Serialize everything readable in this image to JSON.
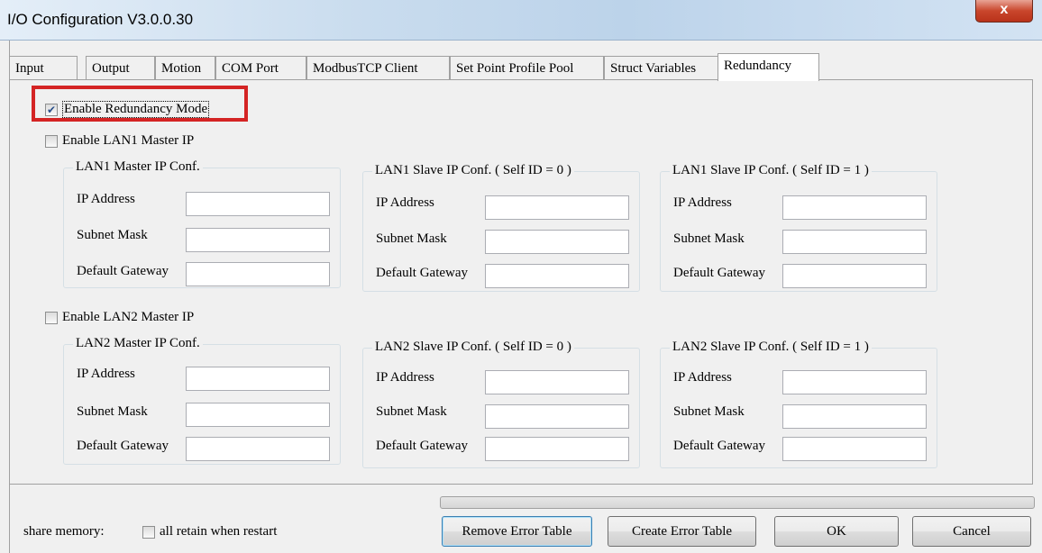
{
  "window": {
    "title": "I/O Configuration V3.0.0.30",
    "close_glyph": "x"
  },
  "tabs": [
    {
      "label": "Input",
      "active": false
    },
    {
      "label": "Output",
      "active": false
    },
    {
      "label": "Motion",
      "active": false
    },
    {
      "label": "COM Port",
      "active": false
    },
    {
      "label": "ModbusTCP Client",
      "active": false
    },
    {
      "label": "Set Point Profile Pool",
      "active": false
    },
    {
      "label": "Struct Variables",
      "active": false
    },
    {
      "label": "Redundancy",
      "active": true
    }
  ],
  "redundancy": {
    "enable_mode": {
      "label": "Enable Redundancy Mode",
      "checked": true
    },
    "lan1": {
      "enable": {
        "label": "Enable LAN1 Master IP",
        "checked": false
      },
      "groups": [
        {
          "title": "LAN1 Master IP Conf."
        },
        {
          "title": "LAN1 Slave IP Conf. ( Self ID = 0 )"
        },
        {
          "title": "LAN1 Slave IP Conf. ( Self ID = 1 )"
        }
      ]
    },
    "lan2": {
      "enable": {
        "label": "Enable LAN2 Master IP",
        "checked": false
      },
      "groups": [
        {
          "title": "LAN2 Master IP Conf."
        },
        {
          "title": "LAN2 Slave IP Conf. ( Self ID = 0 )"
        },
        {
          "title": "LAN2 Slave IP Conf. ( Self ID = 1 )"
        }
      ]
    },
    "field_labels": {
      "ip": "IP Address",
      "mask": "Subnet Mask",
      "gateway": "Default Gateway"
    }
  },
  "footer": {
    "share_memory_label": "share memory:",
    "retain": {
      "label": "all retain when restart",
      "checked": false
    },
    "progress_fraction": 0,
    "buttons": {
      "remove_error_table": "Remove Error Table",
      "create_error_table": "Create Error Table",
      "ok": "OK",
      "cancel": "Cancel"
    }
  },
  "colors": {
    "highlight": "#d42424",
    "check_mark": "#2a4f8a"
  },
  "icons": {
    "checked": "checkmark-icon",
    "close": "close-icon"
  }
}
